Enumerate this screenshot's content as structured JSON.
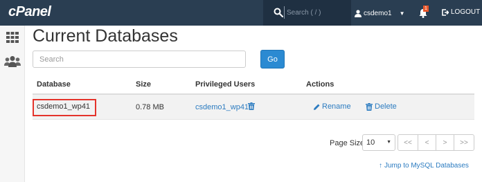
{
  "header": {
    "logo": "cPanel",
    "search_placeholder": "Search ( / )",
    "username": "csdemo1",
    "notification_count": "1",
    "logout_label": "LOGOUT"
  },
  "sidebar": {
    "items": [
      {
        "icon": "grid-icon"
      },
      {
        "icon": "users-icon"
      }
    ]
  },
  "main": {
    "title": "Current Databases",
    "search_placeholder": "Search",
    "go_label": "Go",
    "table": {
      "headers": [
        "Database",
        "Size",
        "Privileged Users",
        "Actions"
      ],
      "rows": [
        {
          "database": "csdemo1_wp41",
          "size": "0.78 MB",
          "privileged_user": "csdemo1_wp41",
          "actions": [
            "Rename",
            "Delete"
          ]
        }
      ]
    },
    "pagination": {
      "page_size_label": "Page Size",
      "page_size_value": "10",
      "buttons": [
        "<<",
        "<",
        ">",
        ">>"
      ]
    },
    "jump_link": "Jump to MySQL Databases"
  },
  "colors": {
    "topbar": "#2a3e52",
    "accent": "#2b8ad2",
    "link": "#2b7bc0",
    "highlight": "#e4332b"
  }
}
